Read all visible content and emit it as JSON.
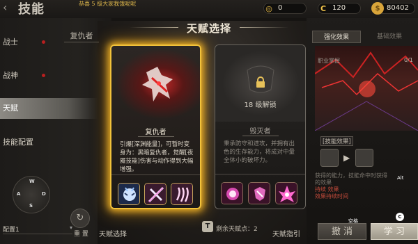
{
  "header": {
    "page_title": "技能",
    "marquee": "恭喜 5 级大家我饿呢呢",
    "currencies": [
      {
        "icon": "coin-token-icon",
        "symbol": "◎",
        "value": "0"
      },
      {
        "icon": "c-currency-icon",
        "symbol": "C",
        "value": "120"
      },
      {
        "icon": "gold-coin-icon",
        "symbol": "$",
        "value": "80402"
      }
    ]
  },
  "sidebar": {
    "items": [
      {
        "label": "战士"
      },
      {
        "label": "战神"
      },
      {
        "label": "天赋"
      },
      {
        "label": "技能配置"
      }
    ],
    "sub_tab": "复仇者"
  },
  "joystick": {
    "up": "W",
    "left": "A",
    "right": "D",
    "down": "S"
  },
  "preset": {
    "label": "配置1"
  },
  "bottom": {
    "reset_label": "重 置",
    "select_label": "天赋选择",
    "points_label": "剩余天赋点：2",
    "points_icon": "T",
    "guide_label": "天赋指引"
  },
  "modal": {
    "title": "天赋选择",
    "cards": [
      {
        "name": "复仇者",
        "desc": "引爆[深渊能量]，可暂时变身为：黑暗复仇者，觉醒[夜魇技能]伤害与动作得到大幅增强。",
        "skills": [
          "skill-icon-demon-face",
          "skill-icon-crossed-blades",
          "skill-icon-claw-strike"
        ]
      },
      {
        "name": "毁灭者",
        "lock_text": "18 级解锁",
        "desc": "秉承防守和进攻，并拥有出色的生存能力，将成对中量全体小的破坏力。",
        "skills": [
          "skill-icon-fire-fist",
          "skill-icon-shield-break",
          "skill-icon-flame-burst"
        ]
      }
    ]
  },
  "right_panel": {
    "tabs": [
      "强化效果",
      "基础效果"
    ],
    "job_text": "职业掌握",
    "ratio": "0/1",
    "section": "[技能效果]",
    "text_lines": [
      "获得的能力，技能命中时获得",
      "的效果",
      "持续 效果",
      "效果持续时间"
    ],
    "alt_key": "Alt",
    "c_key": "C",
    "space_key": "空格",
    "cancel": "撤 消",
    "learn": "学 习"
  }
}
